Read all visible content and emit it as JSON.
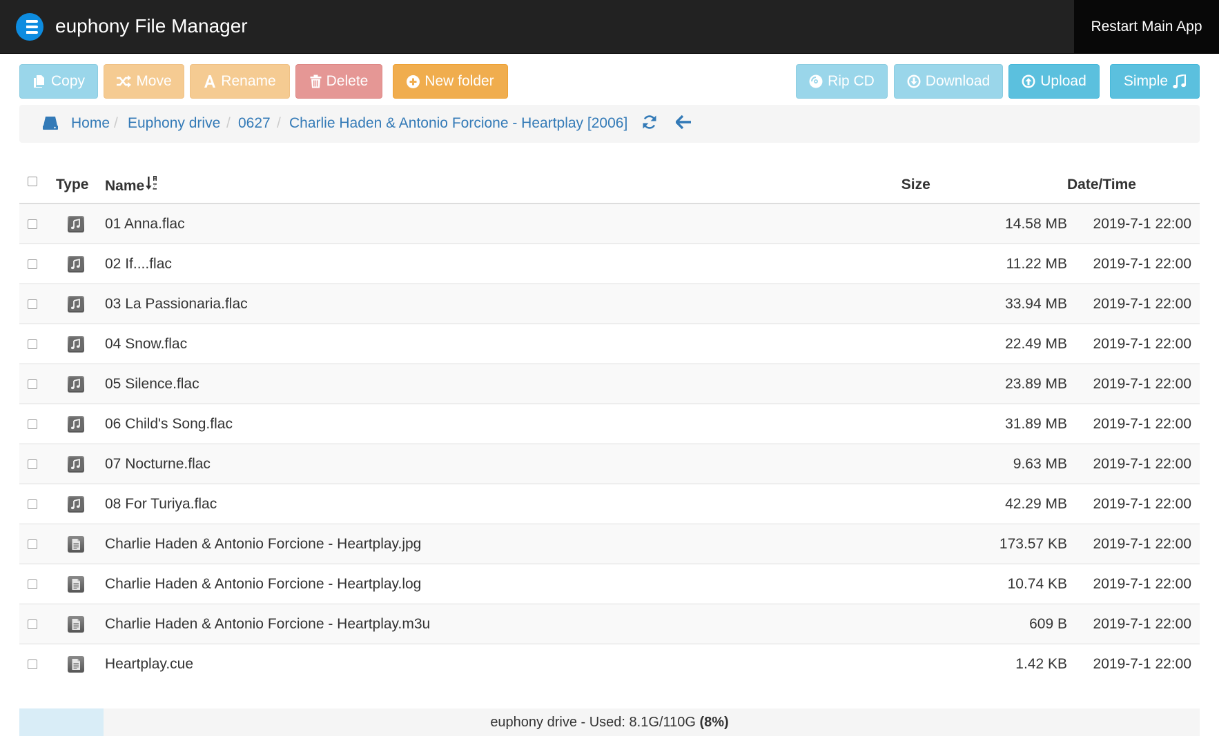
{
  "app": {
    "title": "euphony File Manager",
    "restart_label": "Restart Main App"
  },
  "toolbar": {
    "copy_label": "Copy",
    "move_label": "Move",
    "rename_label": "Rename",
    "delete_label": "Delete",
    "new_folder_label": "New folder",
    "rip_cd_label": "Rip CD",
    "download_label": "Download",
    "upload_label": "Upload",
    "simple_label": "Simple"
  },
  "breadcrumb": {
    "items": [
      "Home",
      "Euphony drive",
      "0627",
      "Charlie Haden & Antonio Forcione - Heartplay [2006]"
    ],
    "separator": "/"
  },
  "table": {
    "columns": {
      "type": "Type",
      "name": "Name",
      "size": "Size",
      "date": "Date/Time"
    },
    "rows": [
      {
        "type": "music",
        "name": "01 Anna.flac",
        "size": "14.58 MB",
        "date": "2019-7-1 22:00"
      },
      {
        "type": "music",
        "name": "02 If....flac",
        "size": "11.22 MB",
        "date": "2019-7-1 22:00"
      },
      {
        "type": "music",
        "name": "03 La Passionaria.flac",
        "size": "33.94 MB",
        "date": "2019-7-1 22:00"
      },
      {
        "type": "music",
        "name": "04 Snow.flac",
        "size": "22.49 MB",
        "date": "2019-7-1 22:00"
      },
      {
        "type": "music",
        "name": "05 Silence.flac",
        "size": "23.89 MB",
        "date": "2019-7-1 22:00"
      },
      {
        "type": "music",
        "name": "06 Child's Song.flac",
        "size": "31.89 MB",
        "date": "2019-7-1 22:00"
      },
      {
        "type": "music",
        "name": "07 Nocturne.flac",
        "size": "9.63 MB",
        "date": "2019-7-1 22:00"
      },
      {
        "type": "music",
        "name": "08 For Turiya.flac",
        "size": "42.29 MB",
        "date": "2019-7-1 22:00"
      },
      {
        "type": "document",
        "name": "Charlie Haden & Antonio Forcione - Heartplay.jpg",
        "size": "173.57 KB",
        "date": "2019-7-1 22:00"
      },
      {
        "type": "document",
        "name": "Charlie Haden & Antonio Forcione - Heartplay.log",
        "size": "10.74 KB",
        "date": "2019-7-1 22:00"
      },
      {
        "type": "document",
        "name": "Charlie Haden & Antonio Forcione - Heartplay.m3u",
        "size": "609 B",
        "date": "2019-7-1 22:00"
      },
      {
        "type": "document",
        "name": "Heartplay.cue",
        "size": "1.42 KB",
        "date": "2019-7-1 22:00"
      }
    ]
  },
  "footer": {
    "text": "euphony drive - Used: 8.1G/110G",
    "percent_label": "(8%)",
    "usage_fraction": 0.08
  },
  "icons": {
    "logo": "euphony-logo-icon",
    "copy": "copy-icon",
    "move": "shuffle-icon",
    "rename": "font-icon",
    "delete": "trash-icon",
    "new_folder": "plus-circle-icon",
    "rip_cd": "disc-icon",
    "download": "download-circle-icon",
    "upload": "upload-circle-icon",
    "simple": "music-note-icon",
    "drive": "hdd-icon",
    "refresh": "refresh-icon",
    "back": "arrow-left-icon",
    "music_file": "music-file-icon",
    "document_file": "document-file-icon",
    "sort": "sort-alpha-icon"
  },
  "colors": {
    "navbar": "#222222",
    "link": "#337ab7",
    "info": "#5bc0de",
    "warning": "#f0ad4e",
    "danger": "#d9534f",
    "progress_fill": "#d9edf7"
  }
}
